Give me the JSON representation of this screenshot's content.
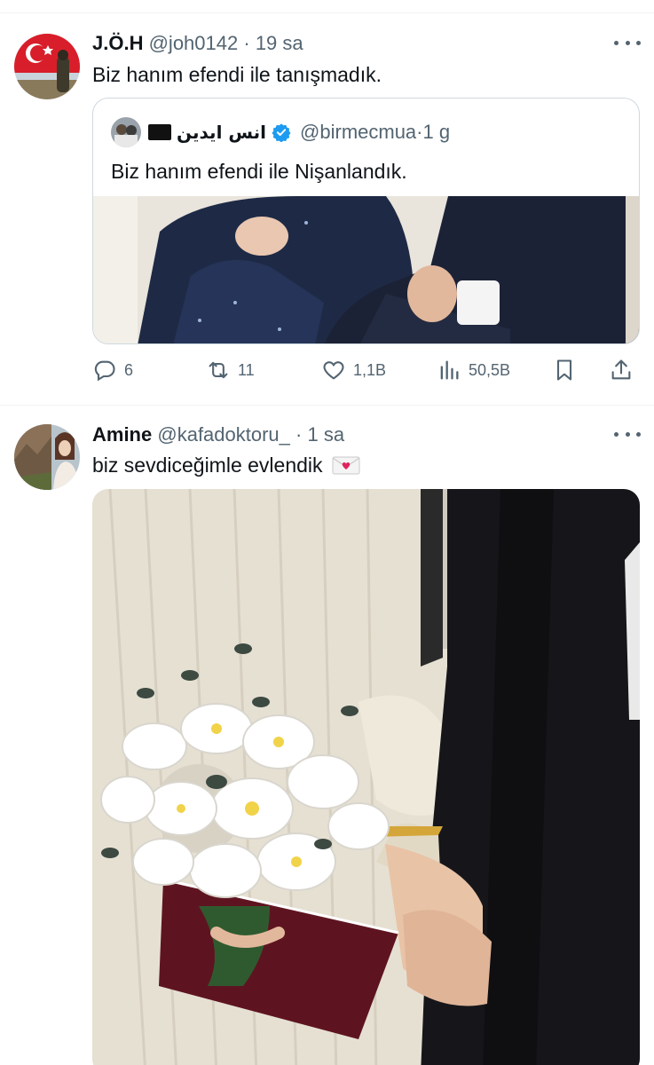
{
  "tweets": [
    {
      "name": "J.Ö.H",
      "handle": "@joh0142",
      "dot": "·",
      "time": "19 sa",
      "text": "Biz hanım efendi ile tanışmadık.",
      "avatar_icon": "turkish-flag-avatar",
      "quote": {
        "name": "انس ایدین",
        "handle": "@birmecmua",
        "dot": "·",
        "time": "1 g",
        "text": "Biz hanım efendi ile Nişanlandık.",
        "verified_color": "#1d9bf0"
      },
      "actions": {
        "replies": "6",
        "retweets": "11",
        "likes": "1,1B",
        "views": "50,5B"
      }
    },
    {
      "name": "Amine",
      "handle": "@kafadoktoru_",
      "dot": "·",
      "time": "1 sa",
      "text": "biz sevdiceğimle evlendik",
      "emoji_icon": "love-letter-icon"
    }
  ],
  "colors": {
    "text": "#0f1419",
    "secondary": "#536471",
    "border": "#cfd9de",
    "verified": "#1d9bf0"
  }
}
